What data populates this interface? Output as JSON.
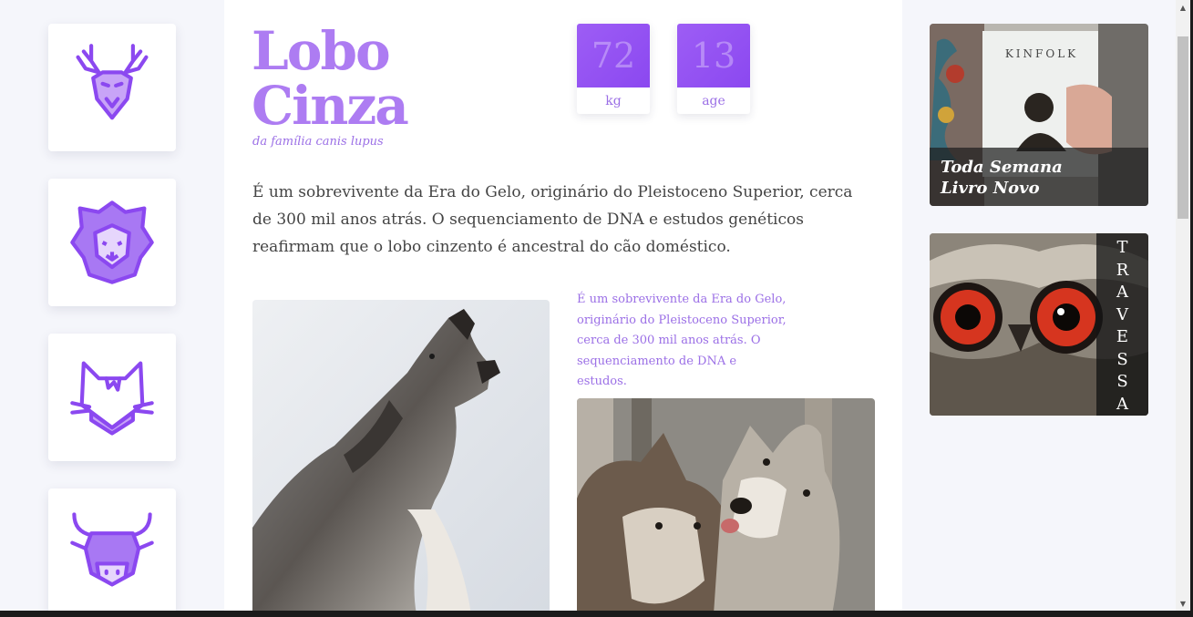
{
  "article": {
    "title_line1": "Lobo",
    "title_line2": "Cinza",
    "subtitle": "da família canis lupus",
    "description": "É um sobrevivente da Era do Gelo, originário do Pleistoceno Superior, cerca de 300 mil anos atrás. O sequenciamento de DNA e estudos genéticos reafirmam que o lobo cinzento é ancestral do cão doméstico.",
    "caption": "É um sobrevivente da Era do Gelo, originário do Pleistoceno Superior, cerca de 300 mil anos atrás. O sequenciamento de DNA e estudos."
  },
  "stats": [
    {
      "value": "72",
      "unit": "kg"
    },
    {
      "value": "13",
      "unit": "age"
    }
  ],
  "sidebar": {
    "animals": [
      {
        "icon": "deer-icon"
      },
      {
        "icon": "lion-icon"
      },
      {
        "icon": "cat-icon"
      },
      {
        "icon": "bull-icon"
      }
    ]
  },
  "ads": {
    "kinfolk": {
      "magazine": "KINFOLK",
      "line1": "Toda Semana",
      "line2": "Livro Novo"
    },
    "travessa": {
      "letters": [
        "T",
        "R",
        "A",
        "V",
        "E",
        "S",
        "S",
        "A"
      ]
    }
  },
  "colors": {
    "accent": "#ad7cf2",
    "accent_dark": "#8b48f0",
    "text": "#444444"
  }
}
